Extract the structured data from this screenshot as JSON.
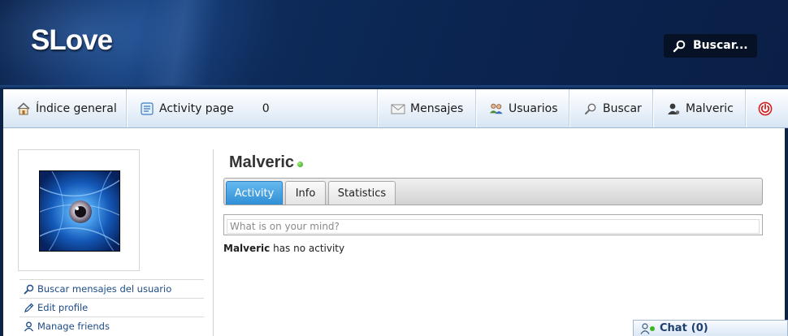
{
  "header": {
    "logo": "SLove",
    "search_label": "Buscar..."
  },
  "nav": {
    "items": [
      {
        "label": "Índice general",
        "icon": "home-icon"
      },
      {
        "label": "Activity page",
        "icon": "activity-page-icon",
        "count": "0"
      },
      {
        "label": "Mensajes",
        "icon": "envelope-icon"
      },
      {
        "label": "Usuarios",
        "icon": "users-icon"
      },
      {
        "label": "Buscar",
        "icon": "search-icon"
      },
      {
        "label": "Malveric",
        "icon": "user-icon"
      }
    ],
    "logout_icon": "power-icon"
  },
  "sidebar": {
    "links": [
      {
        "label": "Buscar mensajes del usuario",
        "icon": "search-icon"
      },
      {
        "label": "Edit profile",
        "icon": "pencil-icon"
      },
      {
        "label": "Manage friends",
        "icon": "friends-icon"
      }
    ]
  },
  "profile": {
    "name": "Malveric",
    "status": "online",
    "tabs": [
      {
        "label": "Activity",
        "active": true
      },
      {
        "label": "Info",
        "active": false
      },
      {
        "label": "Statistics",
        "active": false
      }
    ],
    "status_placeholder": "What is on your mind?",
    "activity_user": "Malveric",
    "activity_message": "has no activity"
  },
  "chat": {
    "label": "Chat",
    "count": "(0)"
  },
  "colors": {
    "header_bg": "#0c2247",
    "nav_link": "#1c4b86",
    "active_tab": "#2f8fd6",
    "online": "#2e9a13",
    "logout": "#d42020"
  }
}
